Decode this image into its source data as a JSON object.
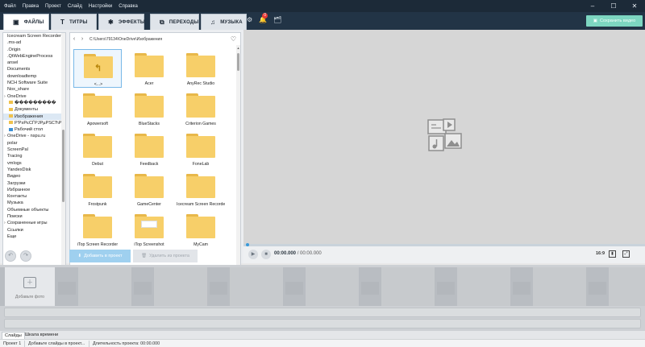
{
  "menu": [
    "Файл",
    "Правка",
    "Проект",
    "Слайд",
    "Настройки",
    "Справка"
  ],
  "window_controls": [
    "‒",
    "☐",
    "✕"
  ],
  "tabs": [
    {
      "label": "ФАЙЛЫ",
      "icon": "monitor-icon",
      "glyph": "▣"
    },
    {
      "label": "ТИТРЫ",
      "icon": "text-icon",
      "glyph": "T"
    },
    {
      "label": "ЭФФЕКТЫ",
      "icon": "effects-icon",
      "glyph": "✱"
    },
    {
      "label": "ПЕРЕХОДЫ",
      "icon": "transitions-icon",
      "glyph": "⧉"
    },
    {
      "label": "МУЗЫКА",
      "icon": "music-icon",
      "glyph": "♫"
    }
  ],
  "toolbar": {
    "notification_count": "0",
    "save_label": "Сохранить видео"
  },
  "tree": {
    "items": [
      {
        "label": "Icecream Screen Recorder",
        "type": "folder"
      },
      {
        "label": ".ms-ad",
        "type": "folder"
      },
      {
        "label": ".Origin",
        "type": "folder"
      },
      {
        "label": ".QtWebEngineProcess",
        "type": "folder"
      },
      {
        "label": "ansel",
        "type": "folder"
      },
      {
        "label": "Documents",
        "type": "folder"
      },
      {
        "label": "downloadtemp",
        "type": "folder"
      },
      {
        "label": "NCH Software Suite",
        "type": "folder"
      },
      {
        "label": "Nox_share",
        "type": "folder"
      },
      {
        "label": "OneDrive",
        "type": "expand"
      },
      {
        "label": "���������",
        "type": "folder"
      },
      {
        "label": "Документы",
        "type": "folder"
      },
      {
        "label": "Изображения",
        "type": "folder",
        "selected": true
      },
      {
        "label": "Р'РѕРєСЃРЈРµРЅСЋРЅС‹Рµ",
        "type": "folder"
      },
      {
        "label": "Рабочий стол",
        "type": "folder"
      },
      {
        "label": "OneDrive - nspu.ru",
        "type": "expand"
      },
      {
        "label": "polar",
        "type": "folder"
      },
      {
        "label": "ScreenPal",
        "type": "folder"
      },
      {
        "label": "Tracing",
        "type": "folder"
      },
      {
        "label": "vmlogs",
        "type": "folder"
      },
      {
        "label": "YandexDisk",
        "type": "folder"
      },
      {
        "label": "Видео",
        "type": "folder"
      },
      {
        "label": "Загрузки",
        "type": "folder"
      },
      {
        "label": "Избранное",
        "type": "folder"
      },
      {
        "label": "Контакты",
        "type": "folder"
      },
      {
        "label": "Музыка",
        "type": "folder"
      },
      {
        "label": "Объемные объекты",
        "type": "folder"
      },
      {
        "label": "Поиски",
        "type": "folder"
      },
      {
        "label": "Сохраненные игры",
        "type": "expand"
      },
      {
        "label": "Ссылки",
        "type": "folder"
      },
      {
        "label": "Еще",
        "type": "folder"
      }
    ]
  },
  "browser": {
    "path": "C:\\Users\\79134\\OneDrive\\Изображения",
    "files": [
      {
        "name": "<...>",
        "kind": "up",
        "selected": true
      },
      {
        "name": "Acer",
        "kind": "folder"
      },
      {
        "name": "AnyRec Studio",
        "kind": "folder"
      },
      {
        "name": "Apowersoft",
        "kind": "folder"
      },
      {
        "name": "BlueStacks",
        "kind": "folder"
      },
      {
        "name": "Criterion Games",
        "kind": "folder"
      },
      {
        "name": "Debut",
        "kind": "folder"
      },
      {
        "name": "Feedback",
        "kind": "folder"
      },
      {
        "name": "FoneLab",
        "kind": "folder"
      },
      {
        "name": "Frostpunk",
        "kind": "folder"
      },
      {
        "name": "GameCenter",
        "kind": "folder"
      },
      {
        "name": "Icecream Screen Recorder",
        "kind": "folder"
      },
      {
        "name": "iTop Screen Recorder",
        "kind": "folder"
      },
      {
        "name": "iTop Screenshot",
        "kind": "folder"
      },
      {
        "name": "MyCam",
        "kind": "folder"
      }
    ]
  },
  "actions": {
    "add_label": "Добавить в проект",
    "delete_label": "Удалить из проекта"
  },
  "player": {
    "current_time": "00:00.000",
    "separator": " / ",
    "total_time": "00:00.000",
    "aspect": "16:9"
  },
  "timeline": {
    "add_photo_label": "Добавьте фото"
  },
  "bottom_tabs": [
    "Слайды",
    "Шкала времени"
  ],
  "status": {
    "project": "Проект 1",
    "hint": "Добавьте слайды в проект...",
    "duration": "Длительность проекта: 00:00.000"
  }
}
